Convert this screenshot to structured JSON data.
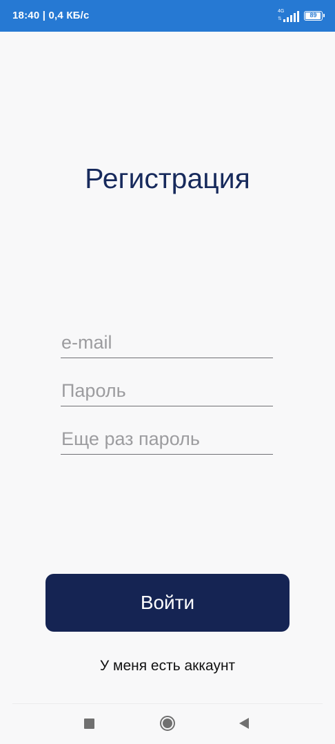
{
  "status_bar": {
    "left_text": "18:40 | 0,4 КБ/с",
    "network_label": "4G",
    "battery_percent": "89",
    "background_color": "#2679d3"
  },
  "screen": {
    "title": "Регистрация",
    "email_placeholder": "e-mail",
    "password_placeholder": "Пароль",
    "password_repeat_placeholder": "Еще раз пароль",
    "login_button_label": "Войти",
    "have_account_link": "У меня есть аккаунт",
    "accent_color": "#152453"
  },
  "nav_bar": {
    "icons": [
      "recent-apps-icon",
      "home-icon",
      "back-icon"
    ]
  }
}
